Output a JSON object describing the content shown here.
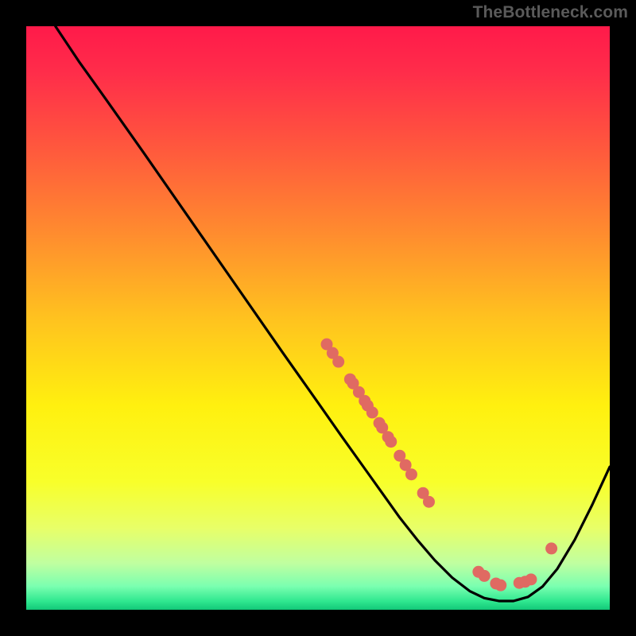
{
  "chart_data": {
    "type": "line",
    "title": "",
    "watermark": "TheBottleneck.com",
    "xlabel": "",
    "ylabel": "",
    "xlim": [
      0,
      100
    ],
    "ylim": [
      0,
      100
    ],
    "gradient_stops": [
      {
        "offset": 0.0,
        "color": "#ff1a4a"
      },
      {
        "offset": 0.08,
        "color": "#ff2d4a"
      },
      {
        "offset": 0.2,
        "color": "#ff553e"
      },
      {
        "offset": 0.35,
        "color": "#ff8a2f"
      },
      {
        "offset": 0.5,
        "color": "#ffc21f"
      },
      {
        "offset": 0.65,
        "color": "#fff00f"
      },
      {
        "offset": 0.78,
        "color": "#f8ff2a"
      },
      {
        "offset": 0.86,
        "color": "#e8ff68"
      },
      {
        "offset": 0.92,
        "color": "#c0ffa0"
      },
      {
        "offset": 0.96,
        "color": "#7affb0"
      },
      {
        "offset": 0.985,
        "color": "#30e890"
      },
      {
        "offset": 1.0,
        "color": "#12c878"
      }
    ],
    "curve": [
      {
        "x": 5.0,
        "y": 100.0
      },
      {
        "x": 9.0,
        "y": 94.0
      },
      {
        "x": 14.0,
        "y": 87.0
      },
      {
        "x": 20.0,
        "y": 78.5
      },
      {
        "x": 28.0,
        "y": 67.0
      },
      {
        "x": 36.0,
        "y": 55.5
      },
      {
        "x": 44.0,
        "y": 44.0
      },
      {
        "x": 50.0,
        "y": 35.5
      },
      {
        "x": 54.0,
        "y": 29.8
      },
      {
        "x": 58.0,
        "y": 24.2
      },
      {
        "x": 61.0,
        "y": 20.0
      },
      {
        "x": 64.0,
        "y": 15.8
      },
      {
        "x": 67.0,
        "y": 12.0
      },
      {
        "x": 70.0,
        "y": 8.5
      },
      {
        "x": 73.0,
        "y": 5.5
      },
      {
        "x": 76.0,
        "y": 3.2
      },
      {
        "x": 78.5,
        "y": 2.0
      },
      {
        "x": 81.0,
        "y": 1.5
      },
      {
        "x": 83.5,
        "y": 1.5
      },
      {
        "x": 86.0,
        "y": 2.2
      },
      {
        "x": 88.5,
        "y": 4.0
      },
      {
        "x": 91.0,
        "y": 7.0
      },
      {
        "x": 94.0,
        "y": 12.0
      },
      {
        "x": 97.0,
        "y": 18.0
      },
      {
        "x": 100.0,
        "y": 24.5
      }
    ],
    "scatter": [
      {
        "x": 51.5,
        "y": 45.5
      },
      {
        "x": 52.5,
        "y": 44.0
      },
      {
        "x": 53.5,
        "y": 42.5
      },
      {
        "x": 55.5,
        "y": 39.5
      },
      {
        "x": 56.0,
        "y": 38.8
      },
      {
        "x": 57.0,
        "y": 37.3
      },
      {
        "x": 58.0,
        "y": 35.8
      },
      {
        "x": 58.5,
        "y": 35.0
      },
      {
        "x": 59.3,
        "y": 33.8
      },
      {
        "x": 60.5,
        "y": 32.0
      },
      {
        "x": 61.0,
        "y": 31.2
      },
      {
        "x": 62.0,
        "y": 29.6
      },
      {
        "x": 62.5,
        "y": 28.8
      },
      {
        "x": 64.0,
        "y": 26.4
      },
      {
        "x": 65.0,
        "y": 24.8
      },
      {
        "x": 66.0,
        "y": 23.2
      },
      {
        "x": 68.0,
        "y": 20.0
      },
      {
        "x": 69.0,
        "y": 18.5
      },
      {
        "x": 77.5,
        "y": 6.5
      },
      {
        "x": 78.5,
        "y": 5.8
      },
      {
        "x": 80.5,
        "y": 4.5
      },
      {
        "x": 81.3,
        "y": 4.2
      },
      {
        "x": 84.5,
        "y": 4.6
      },
      {
        "x": 85.5,
        "y": 4.8
      },
      {
        "x": 86.5,
        "y": 5.2
      },
      {
        "x": 90.0,
        "y": 10.5
      }
    ],
    "curve_color": "#000000",
    "curve_width": 3.2,
    "point_color": "#e06a62",
    "point_radius": 7.5
  }
}
